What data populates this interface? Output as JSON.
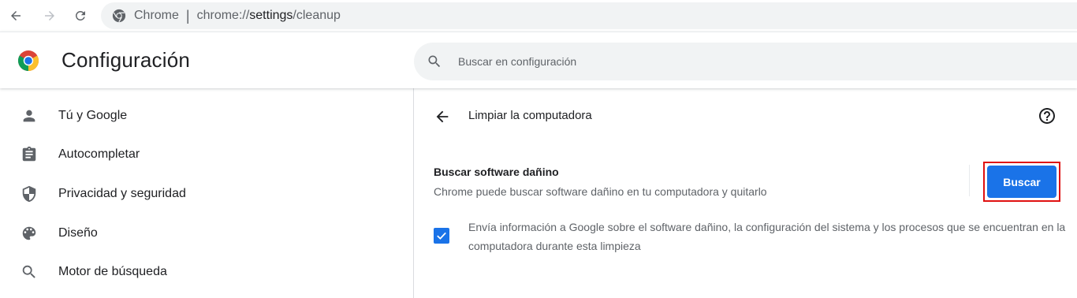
{
  "browser": {
    "site_name": "Chrome",
    "separator": "|",
    "url_scheme": "chrome://",
    "url_host": "settings",
    "url_path": "/cleanup",
    "icons": [
      "back-arrow-icon",
      "forward-arrow-icon",
      "reload-icon",
      "chrome-site-icon"
    ]
  },
  "header": {
    "title": "Configuración",
    "search_placeholder": "Buscar en configuración"
  },
  "sidebar": {
    "items": [
      {
        "label": "Tú y Google",
        "icon": "person-icon"
      },
      {
        "label": "Autocompletar",
        "icon": "clipboard-icon"
      },
      {
        "label": "Privacidad y seguridad",
        "icon": "shield-icon"
      },
      {
        "label": "Diseño",
        "icon": "palette-icon"
      },
      {
        "label": "Motor de búsqueda",
        "icon": "search-icon"
      }
    ]
  },
  "main": {
    "subpage_title": "Limpiar la computadora",
    "scan": {
      "title": "Buscar software dañino",
      "description": "Chrome puede buscar software dañino en tu computadora y quitarlo",
      "button_label": "Buscar"
    },
    "report": {
      "checked": true,
      "text": "Envía información a Google sobre el software dañino, la configuración del sistema y los procesos que se encuentran en la computadora durante esta limpieza"
    }
  },
  "colors": {
    "accent": "#1a73e8",
    "highlight": "#e01111",
    "text_primary": "#202124",
    "text_secondary": "#5f6368"
  }
}
